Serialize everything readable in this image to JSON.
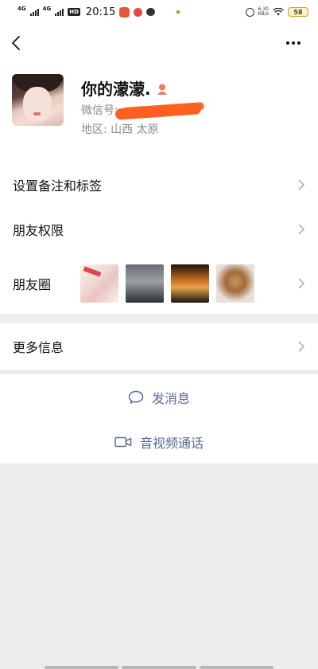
{
  "status_bar": {
    "network_1": "4G",
    "network_2": "4G",
    "hd_label": "HD",
    "time": "20:15",
    "speed_value": "6.30",
    "speed_unit": "KB/s",
    "battery": "58"
  },
  "profile": {
    "nickname": "你的濛濛.",
    "wechat_id_label": "微信号:",
    "region_label": "地区:",
    "region_value": "山西  太原"
  },
  "rows": {
    "tags_label": "设置备注和标签",
    "permissions_label": "朋友权限",
    "moments_label": "朋友圈",
    "more_info_label": "更多信息"
  },
  "actions": {
    "message_label": "发消息",
    "call_label": "音视频通话"
  },
  "colors": {
    "link_blue": "#576b95",
    "background": "#ededed",
    "redaction": "#ff5f1f"
  }
}
